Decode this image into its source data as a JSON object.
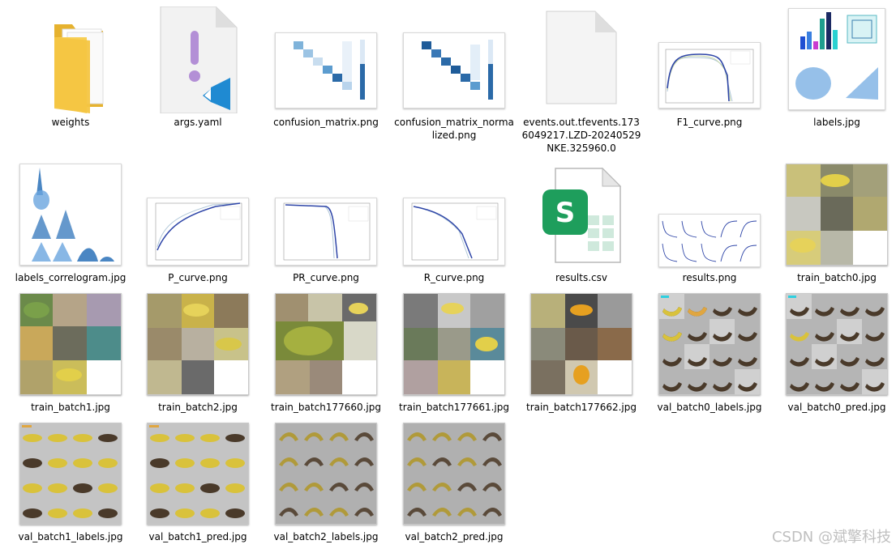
{
  "files": [
    {
      "name": "weights",
      "type": "folder"
    },
    {
      "name": "args.yaml",
      "type": "yaml"
    },
    {
      "name": "confusion_matrix.png",
      "type": "png"
    },
    {
      "name": "confusion_matrix_normalized.png",
      "type": "png"
    },
    {
      "name": "events.out.tfevents.1736049217.LZD-20240529NKE.325960.0",
      "type": "file"
    },
    {
      "name": "F1_curve.png",
      "type": "png"
    },
    {
      "name": "labels.jpg",
      "type": "jpg"
    },
    {
      "name": "labels_correlogram.jpg",
      "type": "jpg"
    },
    {
      "name": "P_curve.png",
      "type": "png"
    },
    {
      "name": "PR_curve.png",
      "type": "png"
    },
    {
      "name": "R_curve.png",
      "type": "png"
    },
    {
      "name": "results.csv",
      "type": "csv"
    },
    {
      "name": "results.png",
      "type": "png"
    },
    {
      "name": "train_batch0.jpg",
      "type": "jpg"
    },
    {
      "name": "train_batch1.jpg",
      "type": "jpg"
    },
    {
      "name": "train_batch2.jpg",
      "type": "jpg"
    },
    {
      "name": "train_batch177660.jpg",
      "type": "jpg"
    },
    {
      "name": "train_batch177661.jpg",
      "type": "jpg"
    },
    {
      "name": "train_batch177662.jpg",
      "type": "jpg"
    },
    {
      "name": "val_batch0_labels.jpg",
      "type": "jpg"
    },
    {
      "name": "val_batch0_pred.jpg",
      "type": "jpg"
    },
    {
      "name": "val_batch1_labels.jpg",
      "type": "jpg"
    },
    {
      "name": "val_batch1_pred.jpg",
      "type": "jpg"
    },
    {
      "name": "val_batch2_labels.jpg",
      "type": "jpg"
    },
    {
      "name": "val_batch2_pred.jpg",
      "type": "jpg"
    }
  ],
  "watermark": "CSDN @斌擎科技",
  "colors": {
    "folder": "#f4c542",
    "vscode_blue": "#1f8ad2",
    "yaml_mark": "#b38fd6",
    "csv_green": "#1e9e5c",
    "heat_blue": "#2b6aa8",
    "banana_yellow": "#d9c23b"
  }
}
